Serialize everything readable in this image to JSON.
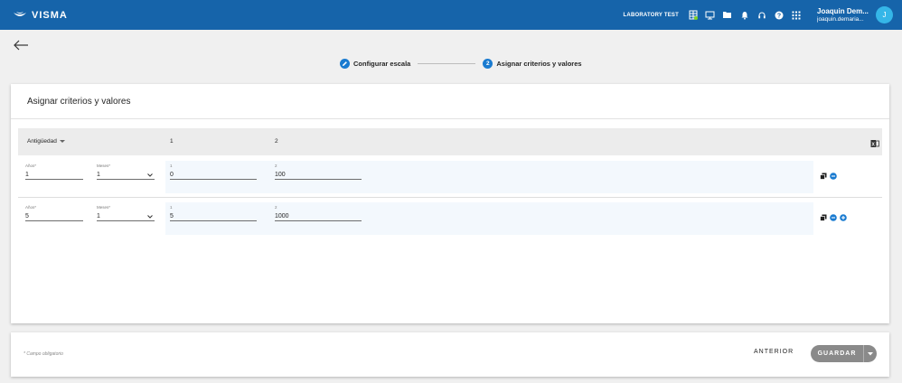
{
  "header": {
    "brand": "VISMA",
    "tenant": "LABORATORY TEST",
    "user_name": "Joaquin Dem...",
    "user_email": "joaquin.demaria...",
    "avatar_letter": "J"
  },
  "stepper": {
    "steps": [
      {
        "label": "Configurar escala",
        "state": "done"
      },
      {
        "number": "2",
        "label": "Asignar criterios y valores",
        "state": "active"
      }
    ]
  },
  "card": {
    "title": "Asignar criterios y valores",
    "columns": [
      "Antigüedad",
      "1",
      "2"
    ],
    "rows": [
      {
        "years_label": "Años*",
        "years": "1",
        "months_label": "Meses*",
        "months": "1",
        "v1_label": "1",
        "v1": "0",
        "v2_label": "2",
        "v2": "100"
      },
      {
        "years_label": "Años*",
        "years": "5",
        "months_label": "Meses*",
        "months": "1",
        "v1_label": "1",
        "v1": "5",
        "v2_label": "2",
        "v2": "1000"
      }
    ]
  },
  "footer": {
    "required_note": "* Campo obligatorio",
    "prev_label": "ANTERIOR",
    "save_label": "GUARDAR"
  },
  "colors": {
    "topbar": "#1664aa",
    "accent": "#1a7bd0",
    "avatar": "#35b6e8",
    "save_button": "#8a8a8a"
  }
}
